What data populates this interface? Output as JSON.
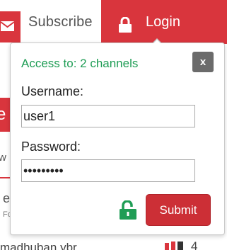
{
  "header": {
    "subscribe_label": "Subscribe",
    "login_label": "Login",
    "subscribe_icon": "envelope-icon",
    "login_icon": "lock-icon"
  },
  "background": {
    "red_block_text": "e",
    "fragment_w": "w",
    "fragment_e": "e",
    "fragment_fo": "Fo",
    "list_user": "madhuban.ybr",
    "list_count": "4"
  },
  "popup": {
    "access_text": "Access to: 2 channels",
    "close_label": "x",
    "username_label": "Username:",
    "username_value": "user1",
    "password_label": "Password:",
    "password_value": "•••••••••",
    "submit_label": "Submit",
    "lock_icon": "unlocked-padlock-icon"
  },
  "colors": {
    "brand_red": "#d9353d",
    "success_green": "#1f9d55",
    "close_gray": "#6b6b6b"
  }
}
